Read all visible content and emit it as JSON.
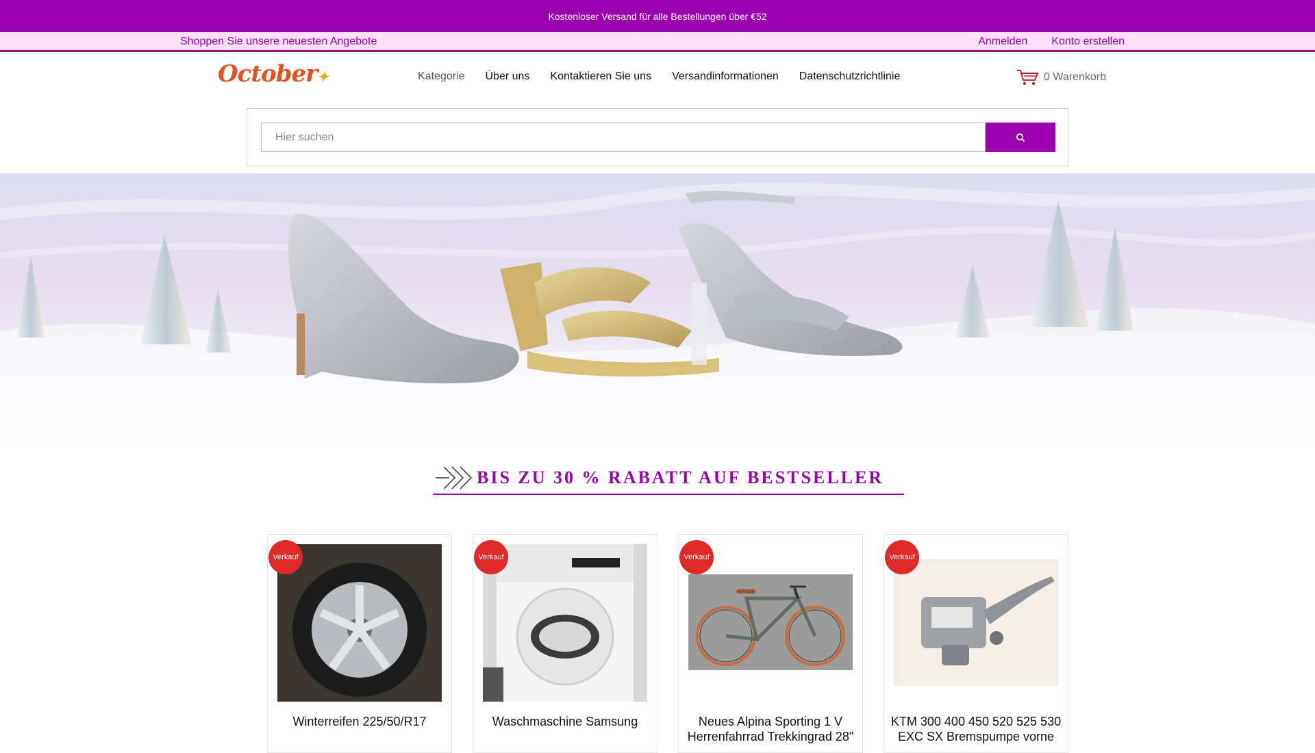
{
  "promo": {
    "text": "Kostenloser Versand für alle Bestellungen über €52"
  },
  "subbar": {
    "left": "Shoppen Sie unsere neuesten Angebote",
    "login": "Anmelden",
    "register": "Konto erstellen"
  },
  "logo": {
    "text": "October"
  },
  "nav": {
    "items": [
      "Kategorie",
      "Über uns",
      "Kontaktieren Sie uns",
      "Versandinformationen",
      "Datenschutzrichtlinie"
    ]
  },
  "cart": {
    "label": "0 Warenkorb"
  },
  "search": {
    "placeholder": "Hier suchen"
  },
  "section": {
    "title": "BIS ZU 30 % RABATT AUF BESTSELLER"
  },
  "products": [
    {
      "badge": "Verkauf",
      "name": "Winterreifen 225/50/R17"
    },
    {
      "badge": "Verkauf",
      "name": "Waschmaschine Samsung"
    },
    {
      "badge": "Verkauf",
      "name": "Neues Alpina Sporting 1 V Herrenfahrrad Trekkingrad 28\""
    },
    {
      "badge": "Verkauf",
      "name": "KTM 300 400 450 520 525 530 EXC SX Bremspumpe vorne"
    }
  ],
  "colors": {
    "brand": "#9b00b0",
    "subbar_bg": "#fde0f7",
    "badge": "#e02a2a",
    "logo": "#e0521e"
  }
}
